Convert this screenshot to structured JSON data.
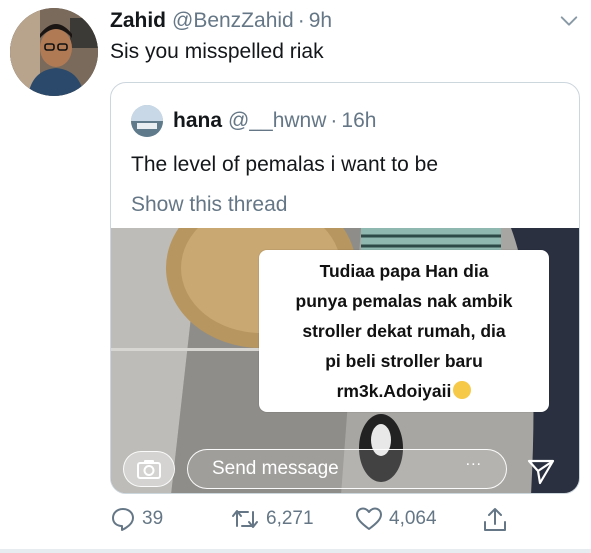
{
  "tweet": {
    "author_name": "Zahid",
    "author_handle": "@BenzZahid",
    "time": "9h",
    "text": "Sis you misspelled riak",
    "menu_icon": "chevron-down-icon"
  },
  "quoted": {
    "author_name": "hana",
    "author_handle": "@__hwnw",
    "time": "16h",
    "text": "The level of pemalas i want to be",
    "show_thread": "Show this thread",
    "media": {
      "caption_lines": [
        "Tudiaa papa Han dia",
        "punya pemalas nak ambik",
        "stroller dekat rumah, dia",
        "pi beli stroller baru",
        "rm3k.Adoiyaii"
      ],
      "caption_emoji": "rolling-on-floor-laughing-emoji",
      "camera_icon": "camera-icon",
      "message_placeholder": "Send message",
      "more_label": "...",
      "send_icon": "send-icon"
    }
  },
  "actions": {
    "replies": "39",
    "retweets": "6,271",
    "likes": "4,064",
    "share_icon": "share-icon"
  },
  "colors": {
    "secondary_text": "#657786",
    "border": "#ccd6dd"
  }
}
